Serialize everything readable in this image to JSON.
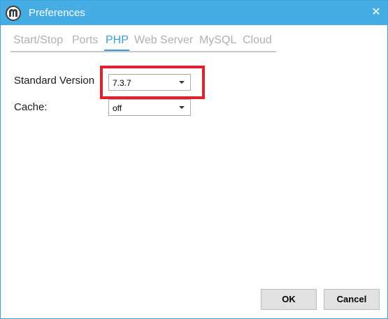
{
  "window": {
    "title": "Preferences",
    "close_glyph": "✕"
  },
  "tabs": [
    {
      "label": "Start/Stop",
      "active": false
    },
    {
      "label": "Ports",
      "active": false
    },
    {
      "label": "PHP",
      "active": true
    },
    {
      "label": "Web Server",
      "active": false
    },
    {
      "label": "MySQL",
      "active": false
    },
    {
      "label": "Cloud",
      "active": false
    }
  ],
  "php": {
    "standard_version_label": "Standard Version",
    "standard_version_value": "7.3.7",
    "cache_label": "Cache:",
    "cache_value": "off"
  },
  "buttons": {
    "ok_label": "OK",
    "cancel_label": "Cancel"
  },
  "colors": {
    "titlebar": "#45ade3",
    "active_tab": "#3c9ad6",
    "inactive_tab": "#b0b0b0",
    "highlight": "#e0202d"
  }
}
